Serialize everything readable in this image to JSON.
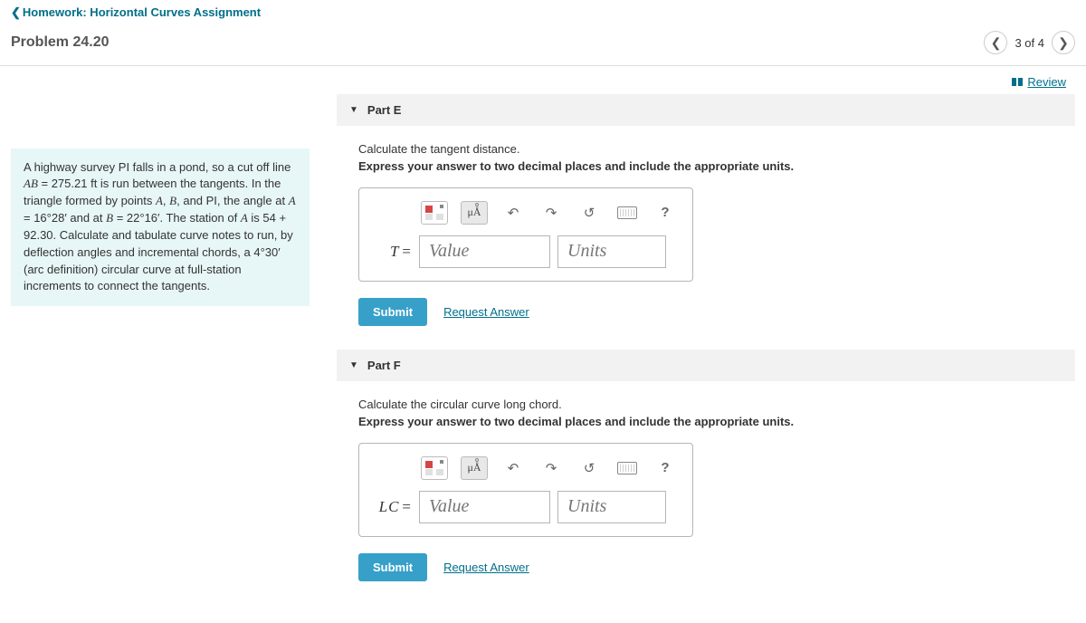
{
  "breadcrumb": "Homework: Horizontal Curves Assignment",
  "problem_title": "Problem 24.20",
  "nav": {
    "position": "3 of 4"
  },
  "review_label": "Review",
  "info_html": "A highway survey PI falls in a pond, so a cut off line <span class='mi'>AB</span> = 275.21 ft is run between the tangents. In the triangle formed by points <span class='mi'>A</span>, <span class='mi'>B</span>, and PI, the angle at <span class='mi'>A</span> = 16°28′ and at <span class='mi'>B</span> = 22°16′. The station of <span class='mi'>A</span> is 54 + 92.30. Calculate and tabulate curve notes to run, by deflection angles and incremental chords, a 4°30′ (arc definition) circular curve at full-station increments to connect the tangents.",
  "parts": [
    {
      "header": "Part E",
      "prompt": "Calculate the tangent distance.",
      "instruction": "Express your answer to two decimal places and include the appropriate units.",
      "variable": "T",
      "value_placeholder": "Value",
      "units_placeholder": "Units",
      "submit": "Submit",
      "request": "Request Answer",
      "units_symbol": "μÅ"
    },
    {
      "header": "Part F",
      "prompt": "Calculate the circular curve long chord.",
      "instruction": "Express your answer to two decimal places and include the appropriate units.",
      "variable": "LC",
      "value_placeholder": "Value",
      "units_placeholder": "Units",
      "submit": "Submit",
      "request": "Request Answer",
      "units_symbol": "μÅ"
    }
  ]
}
